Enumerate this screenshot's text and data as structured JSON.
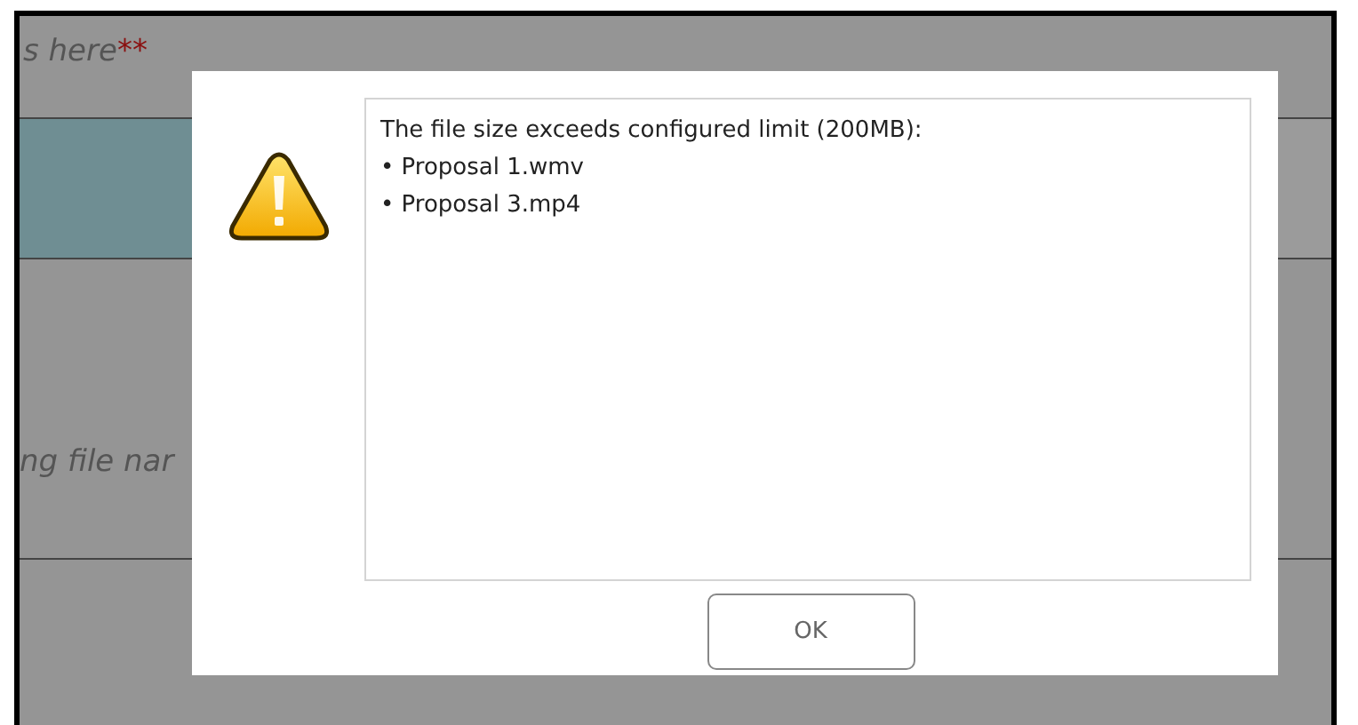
{
  "page_behind": {
    "heading_fragment": "s here",
    "required_mark": "**",
    "field_hint_fragment": "ng file nar"
  },
  "dialog": {
    "kind": "warning",
    "message": "The file size exceeds configured limit (200MB):",
    "files": [
      "• Proposal 1.wmv",
      "• Proposal 3.mp4"
    ],
    "buttons": [
      "OK"
    ]
  }
}
